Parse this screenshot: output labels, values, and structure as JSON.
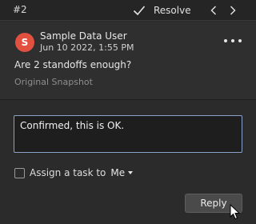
{
  "header": {
    "comment_number": "#2",
    "resolve_label": "Resolve",
    "resolve_icon": "checkmark-icon",
    "prev_icon": "chevron-left-icon",
    "next_icon": "chevron-right-icon"
  },
  "comment": {
    "avatar_initial": "S",
    "avatar_color": "#e2513f",
    "author": "Sample Data User",
    "timestamp": "Jun 10 2022, 1:55 PM",
    "text": "Are 2 standoffs enough?",
    "snapshot_link": "Original Snapshot",
    "more_icon": "more-horizontal-icon"
  },
  "reply": {
    "value": "Confirmed, this is OK."
  },
  "assign": {
    "checked": false,
    "label": "Assign a task to",
    "assignee": "Me"
  },
  "actions": {
    "reply_label": "Reply"
  },
  "colors": {
    "background": "#2b2b2b",
    "input_border": "#8aa2c8"
  }
}
